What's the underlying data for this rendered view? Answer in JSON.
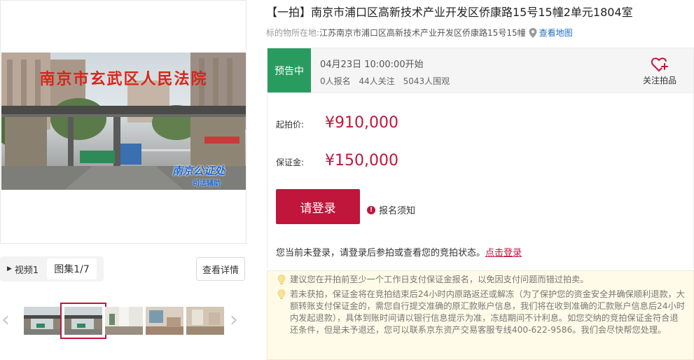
{
  "gallery": {
    "main_photo_text": "南京市玄武区人民法院",
    "watermark_text": "南京公证处",
    "watermark_sub": "司法辅助",
    "tabs": [
      {
        "icon": "play-icon",
        "label": "视频1"
      },
      {
        "label": "图集1/7"
      }
    ],
    "detail_button": "查看详情",
    "thumbnails": [
      "thumb-1",
      "thumb-2",
      "thumb-3",
      "thumb-4",
      "thumb-5"
    ],
    "selected_thumbnail": 2
  },
  "listing": {
    "title": "【一拍】南京市浦口区高新技术产业开发区侨康路15号15幢2单元1804室",
    "location_label": "标的物所在地:",
    "location_value": "江苏南京市浦口区高新技术产业开发区侨康路15号15幢",
    "map_link": "查看地图"
  },
  "status": {
    "tag": "预告中",
    "start_time": "04月23日 10:00:00开始",
    "signups": "0人报名",
    "followers": "44人关注",
    "viewers": "5043人围观",
    "follow_label": "关注拍品"
  },
  "pricing": {
    "start_price_label": "起拍价:",
    "start_price": "¥910,000",
    "deposit_label": "保证金:",
    "deposit": "¥150,000"
  },
  "actions": {
    "login_button": "请登录",
    "notice_label": "报名须知",
    "login_tip": "您当前未登录，请登录后参拍或查看您的竞拍状态。",
    "login_link": "点击登录"
  },
  "tips": [
    "建议您在开拍前至少一个工作日支付保证金报名，以免因支付问题而错过拍卖。",
    "若未获拍，保证金将在竞拍结束后24小时内原路返还或解冻（为了保护您的资金安全并确保顺利退款，大额转账支付保证金的，需您自行提交准确的原汇款账户信息，我们将在收到准确的汇款账户信息后24小时内发起退款），具体到账时间请以银行信息提示为准，冻结期间不计利息。如您交纳的竞拍保证金符合退还条件，但是未予退还，您可以联系京东资产交易客服专线400-622-9586。我们会尽快帮您处理。"
  ],
  "colors": {
    "accent": "#c0163c",
    "status_green": "#2a9b5f",
    "link_blue": "#1b6ec2",
    "tip_bg": "#fffbe8"
  }
}
